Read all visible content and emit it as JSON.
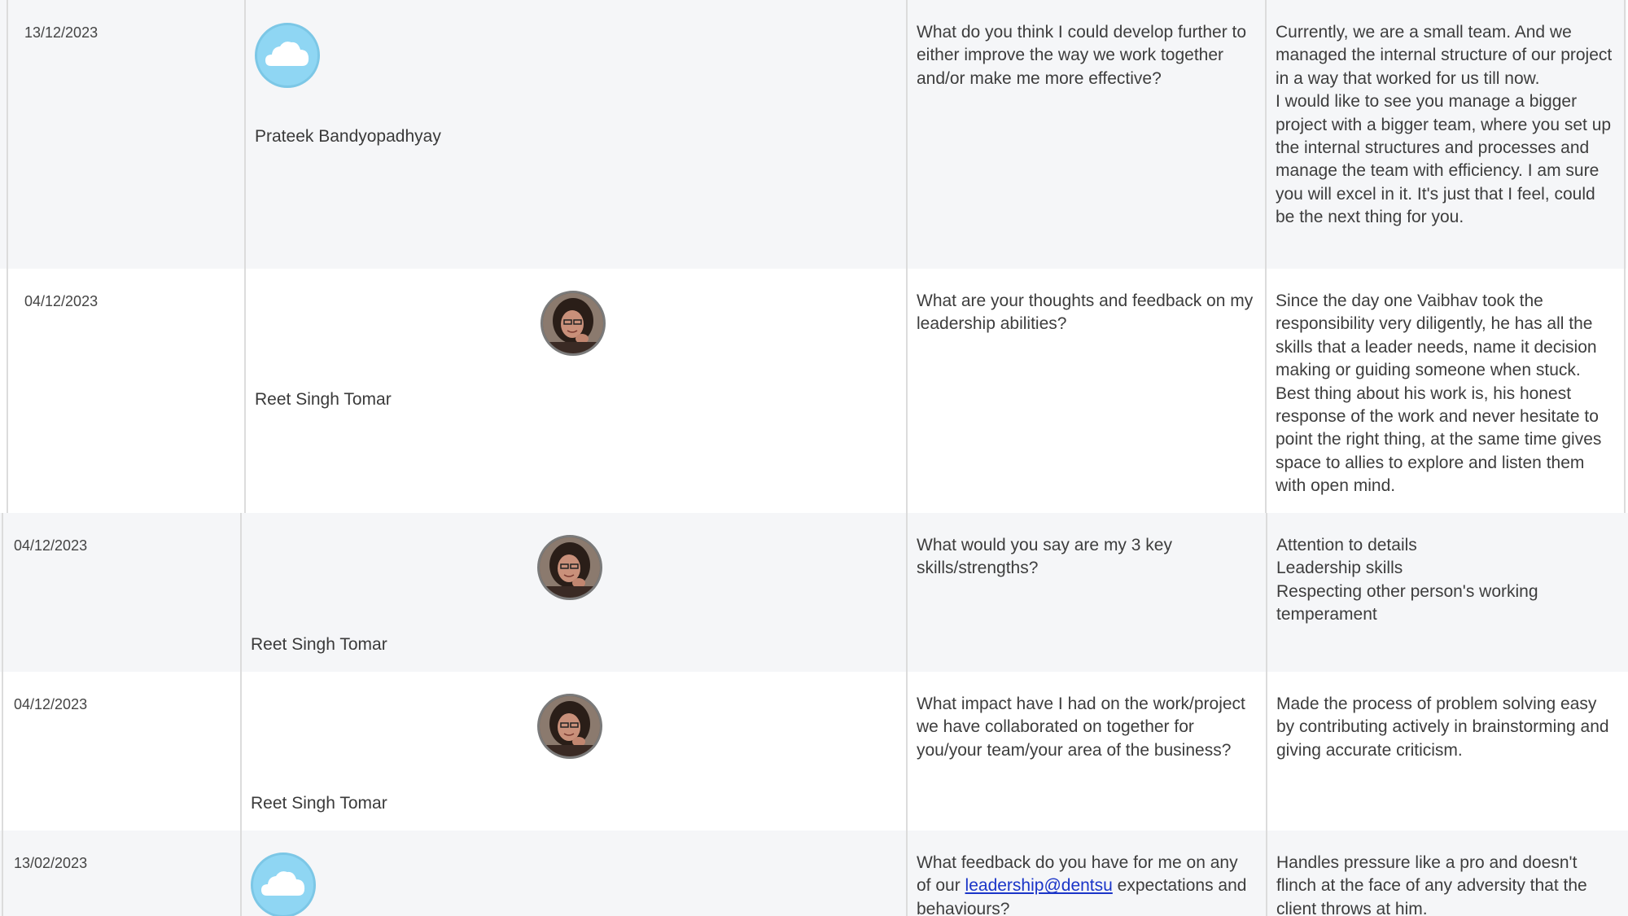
{
  "rows": [
    {
      "date": "13/12/2023",
      "name": "Prateek Bandyopadhyay",
      "avatar_icon": "cloud-icon",
      "question": "What do you think I could develop further to either improve the way we work together and/or make me more effective?",
      "answer": "Currently, we are a small team. And we managed the internal structure of our project in a way that worked for us till now.\nI would like to see you manage a bigger project with a bigger team, where you set up the internal structures and processes and manage the team with efficiency. I am sure you will excel in it. It's just that I feel, could be the next thing for you."
    },
    {
      "date": "04/12/2023",
      "name": "Reet Singh Tomar",
      "avatar_icon": "person-photo",
      "question": "What are your thoughts and feedback on my leadership abilities?",
      "answer": "Since the day one Vaibhav took the responsibility very diligently, he has all the skills that a leader needs, name it decision making or guiding someone when stuck. Best thing about his work is, his honest response of the work and never hesitate to point the right thing, at the same time gives space to allies to explore and listen them with open mind."
    },
    {
      "date": "04/12/2023",
      "name": "Reet Singh Tomar",
      "avatar_icon": "person-photo",
      "question": "What would you say are my 3 key skills/strengths?",
      "answer": "Attention to details\nLeadership skills\nRespecting other person's working temperament"
    },
    {
      "date": "04/12/2023",
      "name": "Reet Singh Tomar",
      "avatar_icon": "person-photo",
      "question": "What impact have I had on the work/project we have collaborated on together for you/your team/your area of the business?",
      "answer": "Made the process of problem solving easy by contributing actively in brainstorming and giving accurate criticism."
    },
    {
      "date": "13/02/2023",
      "name": "",
      "avatar_icon": "cloud-icon",
      "question_before": "What feedback do you have for me on any of our ",
      "question_link": "leadership@dentsu",
      "question_after": " expectations and behaviours?",
      "answer": "Handles pressure like a pro and doesn't flinch at the face of any adversity that the client throws at him."
    }
  ]
}
